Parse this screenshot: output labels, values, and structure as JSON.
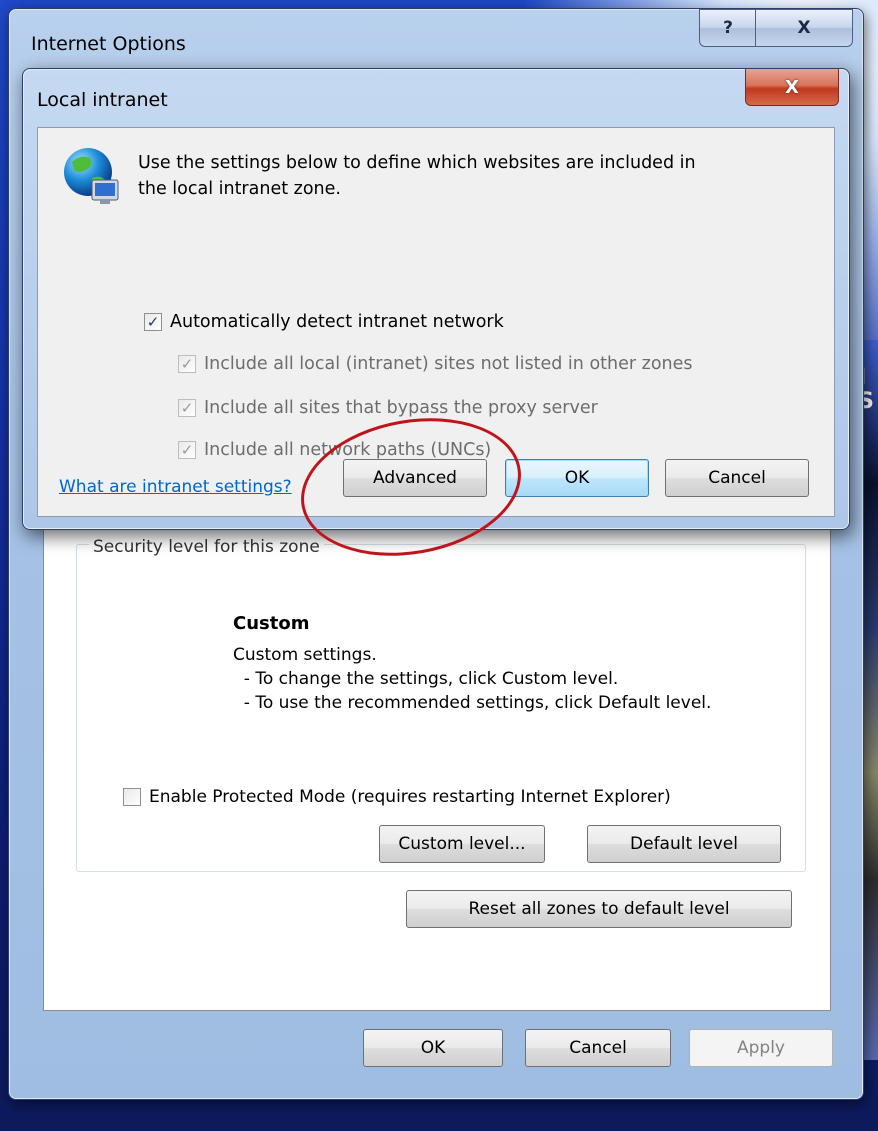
{
  "outer": {
    "title": "Internet Options",
    "help_button": "?",
    "close_button": "X",
    "group_label": "Security level for this zone",
    "level_title": "Custom",
    "level_desc": "Custom settings.\n  - To change the settings, click Custom level.\n  - To use the recommended settings, click Default level.",
    "protected_mode_label": "Enable Protected Mode (requires restarting Internet Explorer)",
    "protected_mode_checked": false,
    "custom_level_button": "Custom level...",
    "default_level_button": "Default level",
    "reset_zones_button": "Reset all zones to default level",
    "ok_button": "OK",
    "cancel_button": "Cancel",
    "apply_button": "Apply"
  },
  "inner": {
    "title": "Local intranet",
    "close_button": "X",
    "intro": "Use the settings below to define which websites are included in\nthe local intranet zone.",
    "options": [
      {
        "label": "Automatically detect intranet network",
        "checked": true,
        "enabled": true
      },
      {
        "label": "Include all local (intranet) sites not listed in other zones",
        "checked": true,
        "enabled": false
      },
      {
        "label": "Include all sites that bypass the proxy server",
        "checked": true,
        "enabled": false
      },
      {
        "label": "Include all network paths (UNCs)",
        "checked": true,
        "enabled": false
      }
    ],
    "help_link": "What are intranet settings?",
    "advanced_button": "Advanced",
    "ok_button": "OK",
    "cancel_button": "Cancel"
  },
  "desktop": {
    "side_text": "'I\n'S"
  },
  "colors": {
    "annotation": "#c0141c",
    "link": "#0066cc"
  }
}
